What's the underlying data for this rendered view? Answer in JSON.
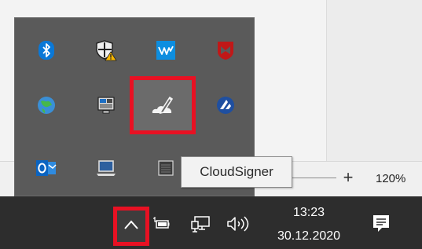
{
  "statusbar": {
    "zoom_plus": "+",
    "zoom_level": "120%"
  },
  "tray_overflow": {
    "icons": [
      {
        "name": "bluetooth-icon"
      },
      {
        "name": "windows-security-warning-icon"
      },
      {
        "name": "waves-icon"
      },
      {
        "name": "mcafee-icon"
      },
      {
        "name": "network-globe-icon"
      },
      {
        "name": "device-manager-icon"
      },
      {
        "name": "cloudsigner-icon"
      },
      {
        "name": "round-blue-app-icon"
      },
      {
        "name": "outlook-icon"
      },
      {
        "name": "laptop-icon"
      },
      {
        "name": "gray-square-icon"
      }
    ],
    "tooltip": "CloudSigner"
  },
  "taskbar": {
    "time": "13:23",
    "date": "30.12.2020"
  },
  "colors": {
    "highlight": "#e81123",
    "taskbar": "#2d2d2d",
    "tray_bg": "#5a5a5a"
  }
}
